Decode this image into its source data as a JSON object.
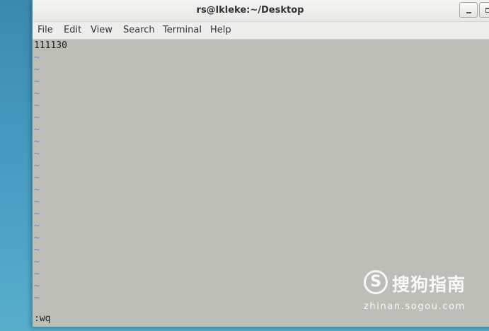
{
  "window": {
    "title": "rs@lkleke:~/Desktop"
  },
  "menubar": {
    "items": [
      "File",
      "Edit",
      "View",
      "Search",
      "Terminal",
      "Help"
    ]
  },
  "terminal": {
    "first_line": "111130",
    "tilde_lines": [
      "~",
      "~",
      "~",
      "~",
      "~",
      "~",
      "~",
      "~",
      "~",
      "~",
      "~",
      "~",
      "~",
      "~",
      "~",
      "~",
      "~",
      "~",
      "~",
      "~",
      "~"
    ],
    "command_line": ":wq"
  },
  "watermark": {
    "logo_letter": "S",
    "brand": "搜狗指南",
    "url": "zhinan.sogou.com"
  },
  "colors": {
    "desktop": "#4aa0c3",
    "terminal_bg": "#bcbeb7",
    "tilde": "#5b8fc0",
    "text": "#1e1e1e"
  }
}
